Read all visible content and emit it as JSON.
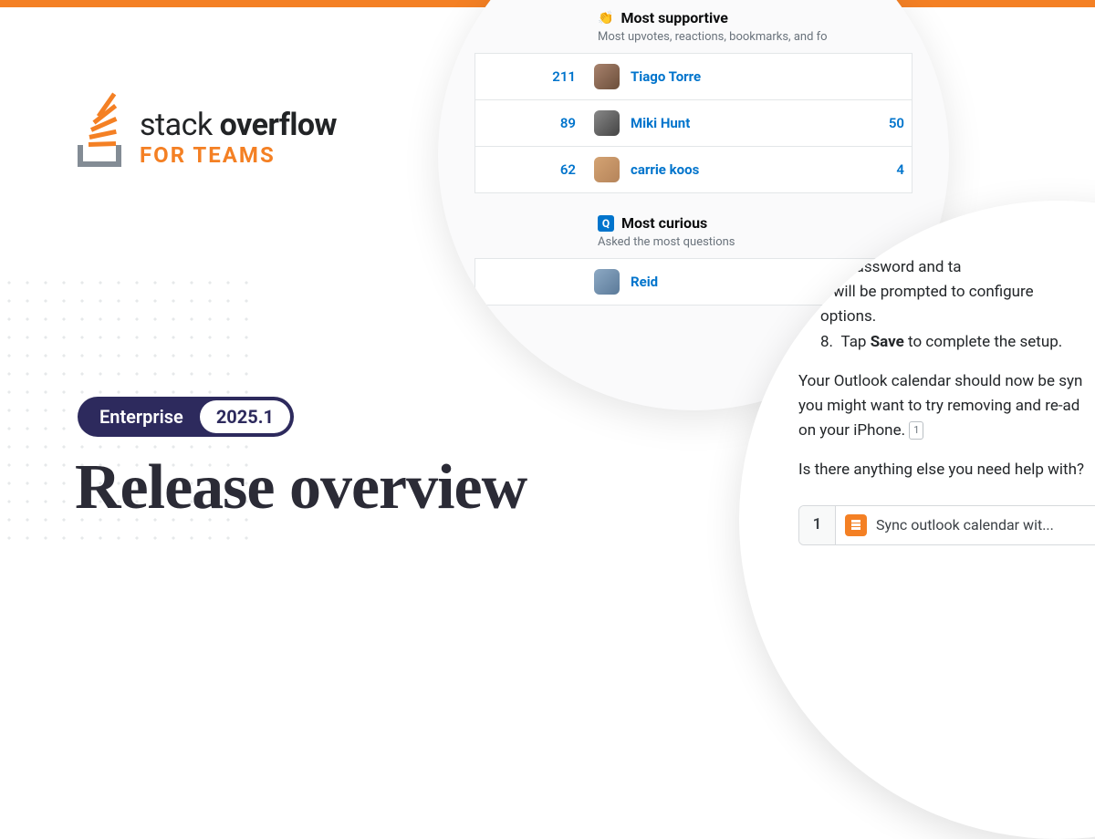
{
  "logo": {
    "line1_a": "stack",
    "line1_b": "overflow",
    "line2": "FOR TEAMS"
  },
  "badge": {
    "label": "Enterprise",
    "version": "2025.1"
  },
  "title": "Release overview",
  "bubble1": {
    "supportive": {
      "title": "Most supportive",
      "subtitle": "Most upvotes, reactions, bookmarks, and fo",
      "rows": [
        {
          "left": "211",
          "name": "Tiago Torre",
          "right": ""
        },
        {
          "left": "89",
          "name": "Miki Hunt",
          "right": "50"
        },
        {
          "left": "62",
          "name": "carrie koos",
          "right": "4"
        }
      ]
    },
    "curious": {
      "title": "Most curious",
      "subtitle": "Asked the most questions",
      "rows": [
        {
          "name": "Reid"
        }
      ]
    }
  },
  "bubble2": {
    "li1_a": "our password and ta",
    "li1_b": "u will be prompted to configure",
    "li1_c": "options.",
    "li2_num": "8.",
    "li2_a": "Tap ",
    "li2_b": "Save",
    "li2_c": " to complete the setup.",
    "p1": "Your Outlook calendar should now be syn",
    "p2": "you might want to try removing and re-ad",
    "p3": "on your iPhone. ",
    "ref1": "1",
    "p4": "Is there anything else you need help with?",
    "ref_row_num": "1",
    "ref_row_text": "Sync outlook calendar wit..."
  }
}
